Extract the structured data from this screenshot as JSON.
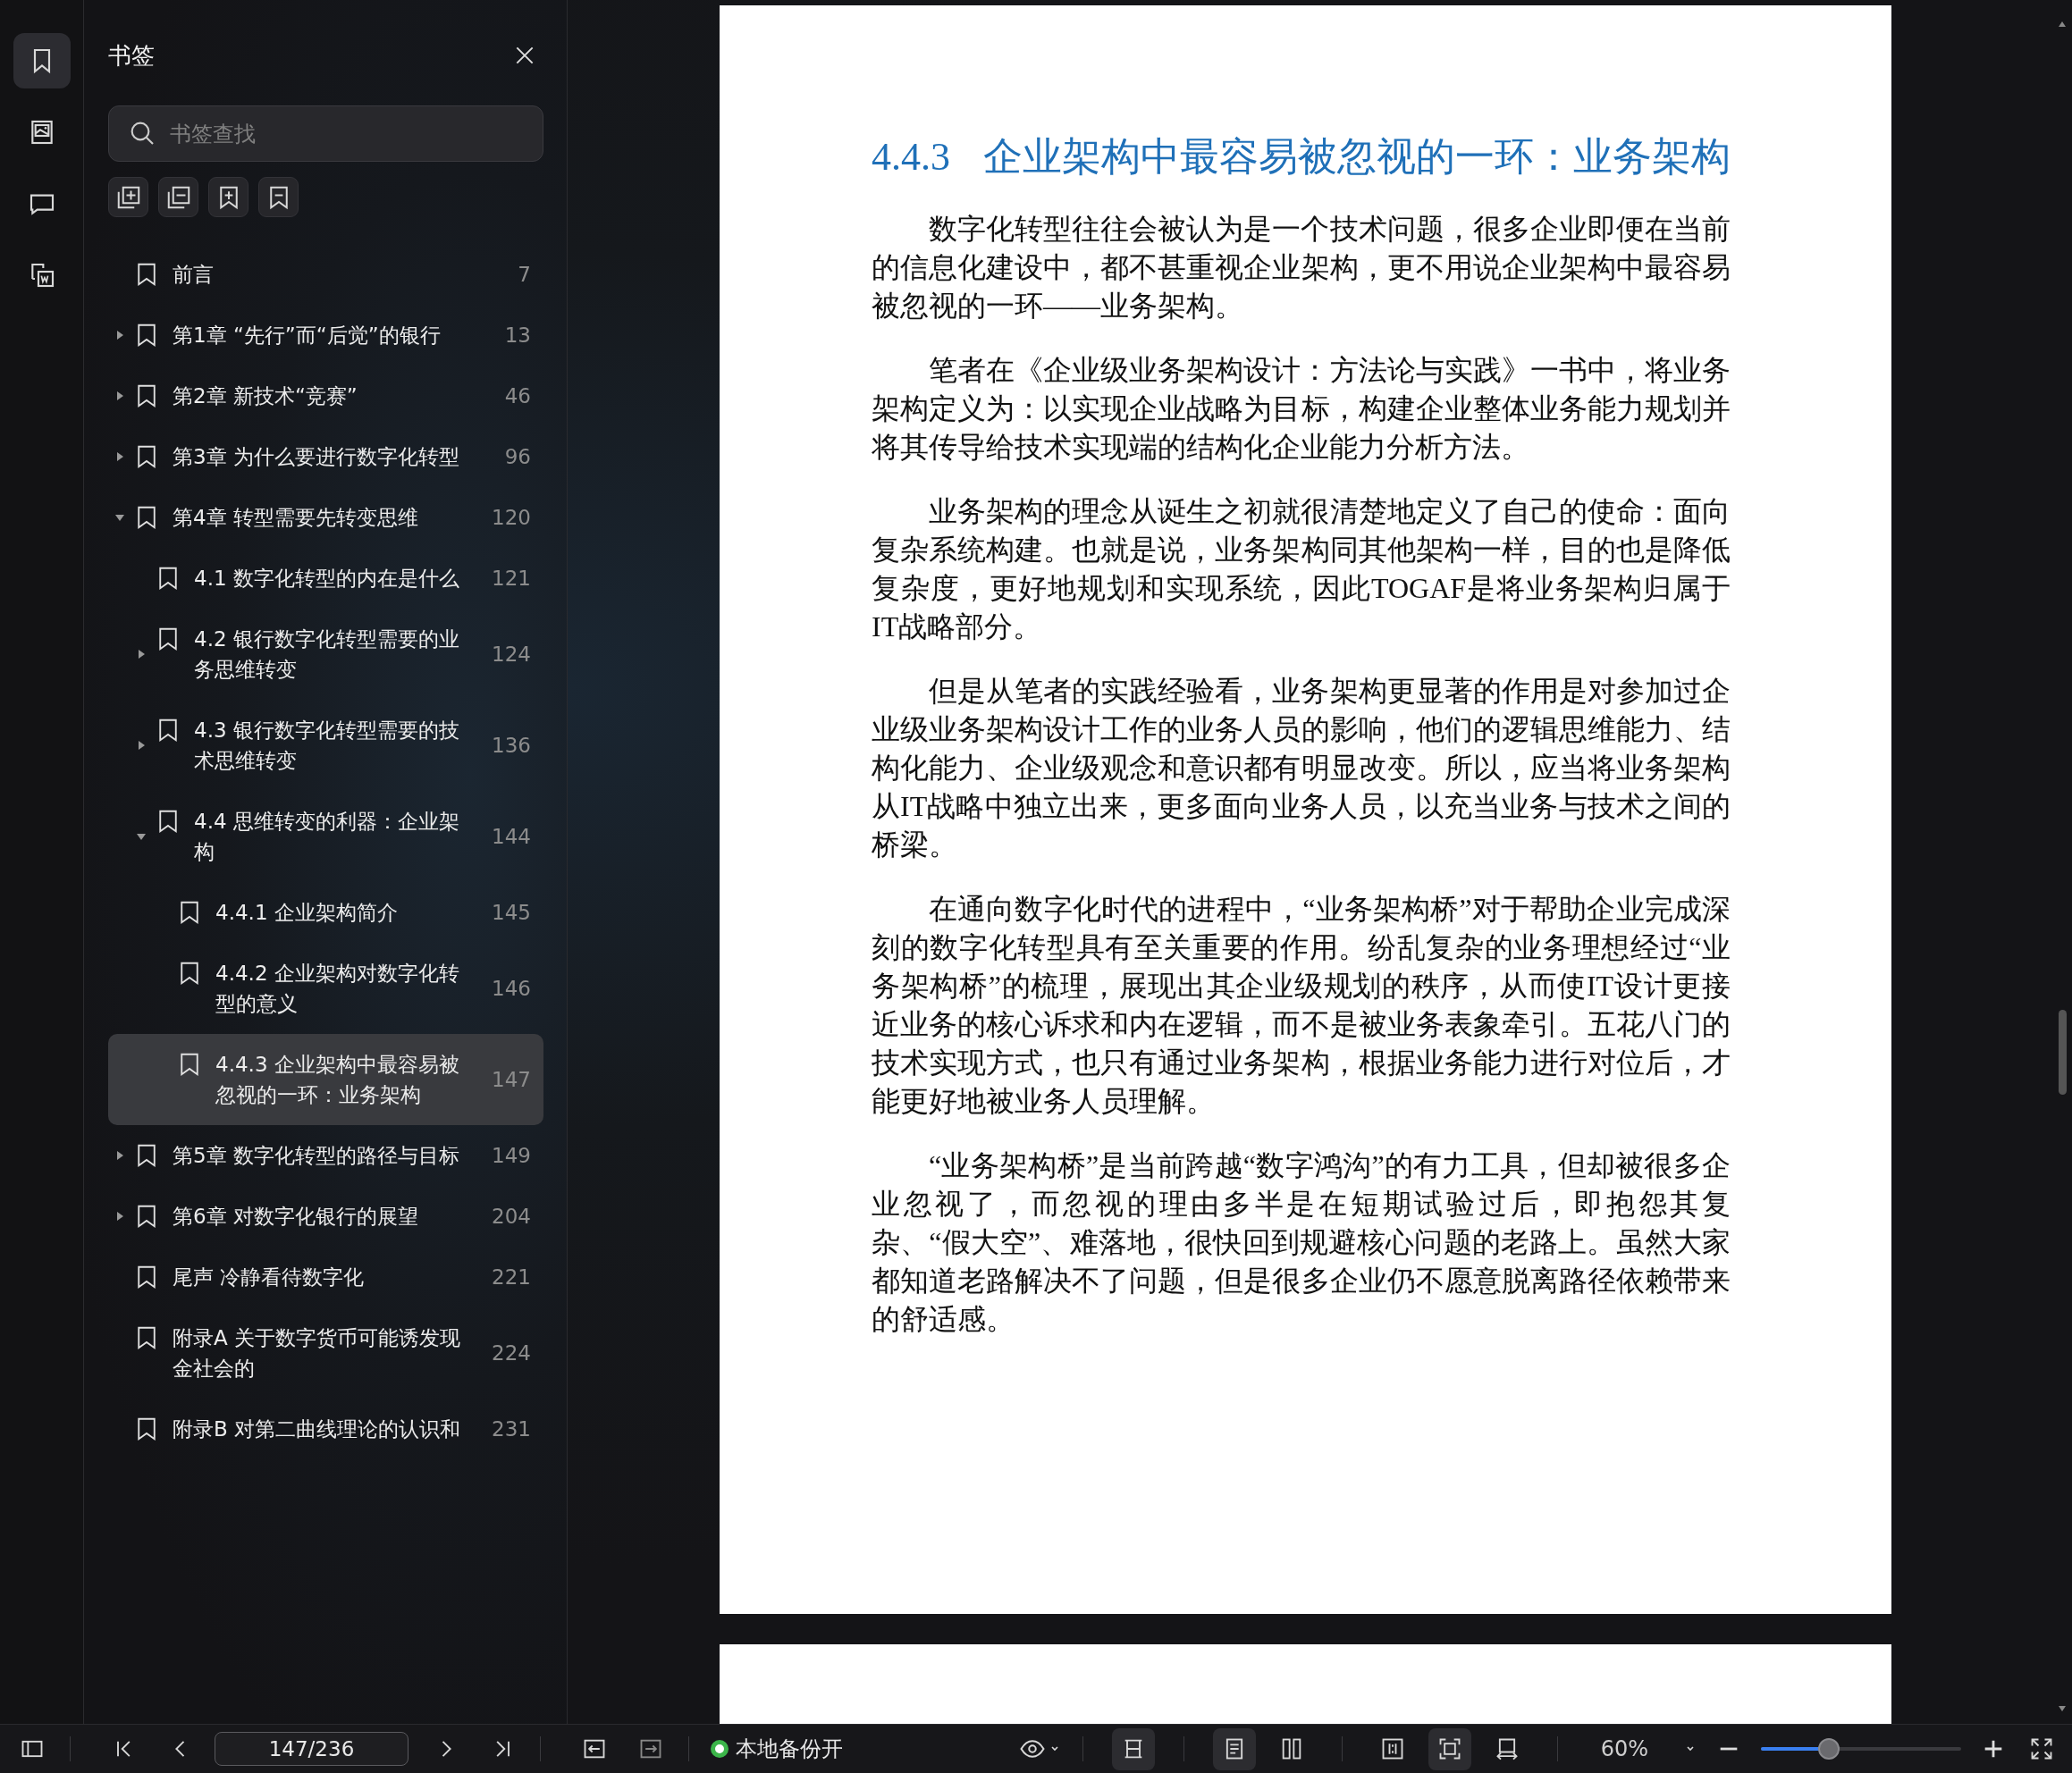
{
  "rail": [
    {
      "selected": true
    },
    {
      "selected": false
    },
    {
      "selected": false
    },
    {
      "selected": false
    }
  ],
  "sidebar": {
    "title": "书签",
    "search": {
      "placeholder": "书签查找"
    },
    "items": [
      {
        "title": "前言",
        "page": "7",
        "selected": false
      },
      {
        "title": "第1章 “先行”而“后觉”的银行",
        "page": "13",
        "expanded": false,
        "selected": false
      },
      {
        "title": "第2章 新技术“竞赛”",
        "page": "46",
        "expanded": false,
        "selected": false
      },
      {
        "title": "第3章 为什么要进行数字化转型",
        "page": "96",
        "expanded": false,
        "selected": false
      },
      {
        "title": "第4章 转型需要先转变思维",
        "page": "120",
        "expanded": true,
        "selected": false,
        "children": [
          {
            "title": "4.1 数字化转型的内在是什么",
            "page": "121",
            "selected": false
          },
          {
            "title": "4.2 银行数字化转型需要的业务思维转变",
            "page": "124",
            "expanded": false,
            "selected": false
          },
          {
            "title": "4.3 银行数字化转型需要的技术思维转变",
            "page": "136",
            "expanded": false,
            "selected": false
          },
          {
            "title": "4.4 思维转变的利器：企业架构",
            "page": "144",
            "expanded": true,
            "selected": false,
            "children": [
              {
                "title": "4.4.1 企业架构简介",
                "page": "145",
                "selected": false
              },
              {
                "title": "4.4.2 企业架构对数字化转型的意义",
                "page": "146",
                "selected": false
              },
              {
                "title": "4.4.3 企业架构中最容易被忽视的一环：业务架构",
                "page": "147",
                "selected": true
              }
            ]
          }
        ]
      },
      {
        "title": "第5章 数字化转型的路径与目标",
        "page": "149",
        "expanded": false,
        "selected": false
      },
      {
        "title": "第6章 对数字化银行的展望",
        "page": "204",
        "expanded": false,
        "selected": false
      },
      {
        "title": "尾声 冷静看待数字化",
        "page": "221",
        "selected": false
      },
      {
        "title": "附录A 关于数字货币可能诱发现金社会的",
        "page": "224",
        "selected": false
      },
      {
        "title": "附录B 对第二曲线理论的认识和",
        "page": "231",
        "selected": false
      }
    ]
  },
  "document": {
    "heading_number": "4.4.3",
    "heading": "企业架构中最容易被忽视的一环：业务架构",
    "paragraphs": [
      "数字化转型往往会被认为是一个技术问题，很多企业即便在当前的信息化建设中，都不甚重视企业架构，更不用说企业架构中最容易被忽视的一环——业务架构。",
      "笔者在《企业级业务架构设计：方法论与实践》一书中，将业务架构定义为：以实现企业战略为目标，构建企业整体业务能力规划并将其传导给技术实现端的结构化企业能力分析方法。",
      "业务架构的理念从诞生之初就很清楚地定义了自己的使命：面向复杂系统构建。也就是说，业务架构同其他架构一样，目的也是降低复杂度，更好地规划和实现系统，因此TOGAF是将业务架构归属于IT战略部分。",
      "但是从笔者的实践经验看，业务架构更显著的作用是对参加过企业级业务架构设计工作的业务人员的影响，他们的逻辑思维能力、结构化能力、企业级观念和意识都有明显改变。所以，应当将业务架构从IT战略中独立出来，更多面向业务人员，以充当业务与技术之间的桥梁。",
      "在通向数字化时代的进程中，“业务架构桥”对于帮助企业完成深刻的数字化转型具有至关重要的作用。纷乱复杂的业务理想经过“业务架构桥”的梳理，展现出其企业级规划的秩序，从而使IT设计更接近业务的核心诉求和内在逻辑，而不是被业务表象牵引。五花八门的技术实现方式，也只有通过业务架构，根据业务能力进行对位后，才能更好地被业务人员理解。",
      "“业务架构桥”是当前跨越“数字鸿沟”的有力工具，但却被很多企业忽视了，而忽视的理由多半是在短期试验过后，即抱怨其复杂、“假大空”、难落地，很快回到规避核心问题的老路上。虽然大家都知道老路解决不了问题，但是很多企业仍不愿意脱离路径依赖带来的舒适感。"
    ]
  },
  "toolbar": {
    "page_field": "147/236",
    "backup": {
      "label": "本地备份开",
      "on": true
    },
    "layout_toggle": {
      "on": true
    },
    "view_buttons": [
      {
        "on": true
      },
      {
        "on": false
      },
      {
        "on": false
      },
      {
        "on": true
      },
      {
        "on": false
      }
    ],
    "zoom": {
      "value": "60%",
      "level": 0.34
    }
  }
}
